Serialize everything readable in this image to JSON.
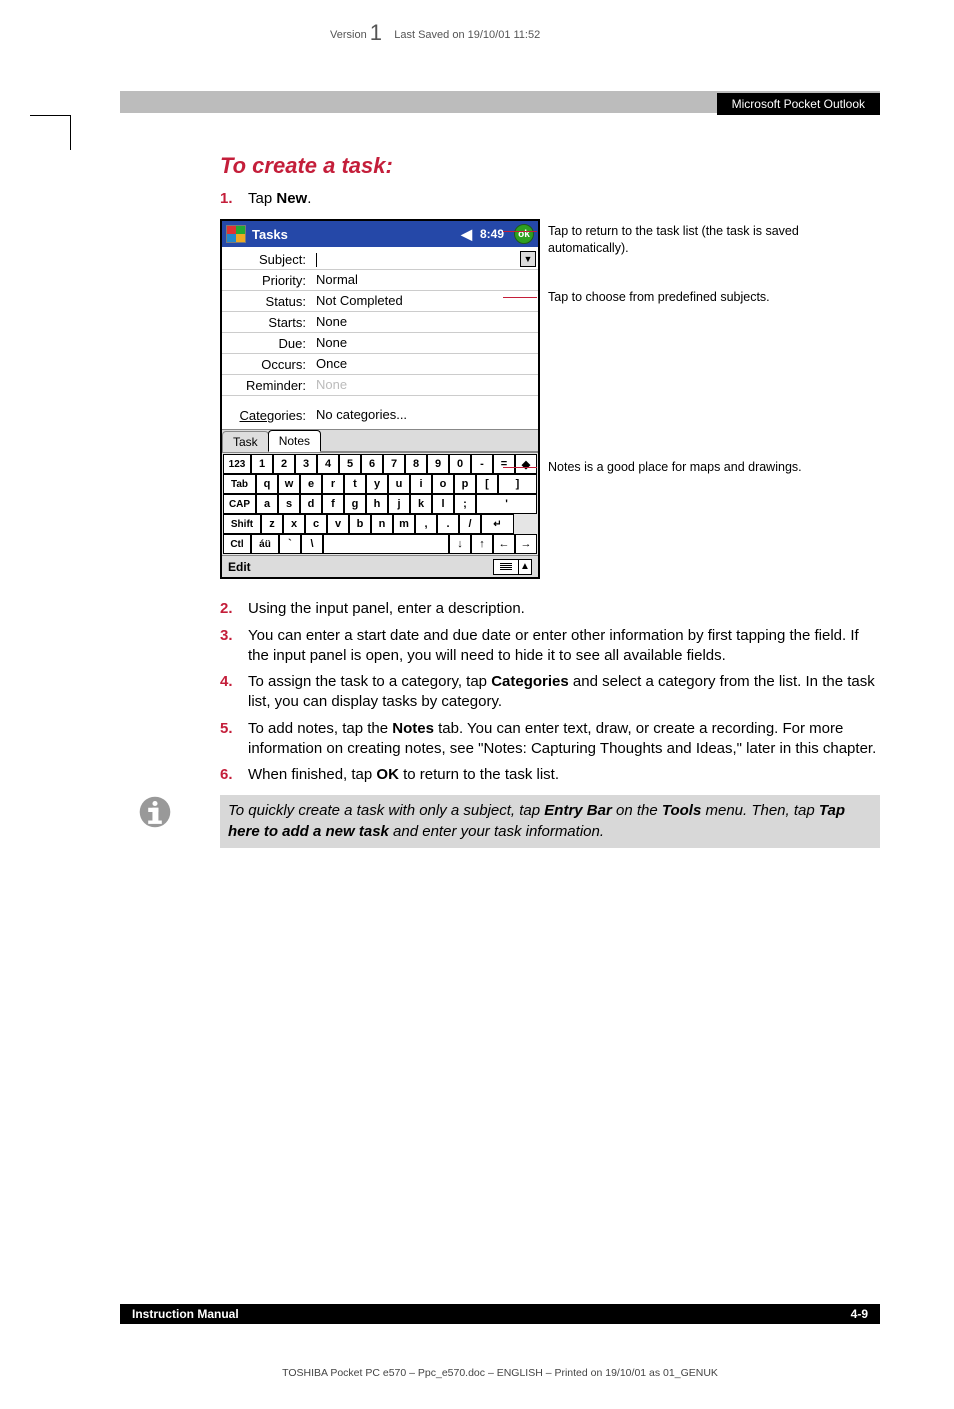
{
  "top_meta": {
    "version_prefix": "Version",
    "version_num": "1",
    "saved": "Last Saved on 19/10/01 11:52"
  },
  "header_bar": {
    "title": "Microsoft Pocket Outlook"
  },
  "section_title": "To create a task:",
  "steps": {
    "s1_pre": "Tap ",
    "s1_bold": "New",
    "s1_post": ".",
    "s2": "Using the input panel, enter a description.",
    "s3": "You can enter a start date and due date or enter other information by first tapping the field. If the input panel is open, you will need to hide it to see all available fields.",
    "s4_pre": "To assign the task to a category, tap ",
    "s4_bold": "Categories",
    "s4_post": " and select a category from the list. In the task list, you can display tasks by category.",
    "s5_pre": "To add notes, tap the ",
    "s5_bold": "Notes",
    "s5_post": " tab. You can enter text, draw, or create a recording. For more information on creating notes, see \"Notes: Capturing Thoughts and Ideas,\" later in this chapter.",
    "s6_pre": "When finished, tap ",
    "s6_bold": "OK",
    "s6_post": " to return to the task list."
  },
  "tip": {
    "pre1": "To quickly create a task with only a subject, tap ",
    "b1": "Entry Bar",
    "mid1": " on the ",
    "b2": "Tools",
    "mid2": " menu. Then, tap ",
    "b3": "Tap here to add a new task",
    "post": " and enter your task information."
  },
  "footer": {
    "left": "Instruction Manual",
    "right": "4-9",
    "note": "TOSHIBA Pocket PC e570   – Ppc_e570.doc – ENGLISH – Printed on 19/10/01 as 01_GENUK"
  },
  "annos": {
    "a1": "Tap to return to the task list (the task is saved automatically).",
    "a2": "Tap to choose from predefined subjects.",
    "a3": "Notes is a good place for maps and drawings."
  },
  "ppc": {
    "title": "Tasks",
    "time": "8:49",
    "ok": "ok",
    "fields": {
      "subject_label": "Subject:",
      "subject_value": "",
      "priority_label": "Priority:",
      "priority_value": "Normal",
      "status_label": "Status:",
      "status_value": "Not Completed",
      "starts_label": "Starts:",
      "starts_value": "None",
      "due_label": "Due:",
      "due_value": "None",
      "occurs_label": "Occurs:",
      "occurs_value": "Once",
      "reminder_label": "Reminder:",
      "reminder_value": "None",
      "categories_label": "Categories:",
      "categories_value": "No categories..."
    },
    "tabs": {
      "task": "Task",
      "notes": "Notes"
    },
    "keyboard": {
      "row1": [
        "123",
        "1",
        "2",
        "3",
        "4",
        "5",
        "6",
        "7",
        "8",
        "9",
        "0",
        "-",
        "=",
        "◆"
      ],
      "row2": [
        "Tab",
        "q",
        "w",
        "e",
        "r",
        "t",
        "y",
        "u",
        "i",
        "o",
        "p",
        "[",
        "]"
      ],
      "row3": [
        "CAP",
        "a",
        "s",
        "d",
        "f",
        "g",
        "h",
        "j",
        "k",
        "l",
        ";",
        "'"
      ],
      "row4": [
        "Shift",
        "z",
        "x",
        "c",
        "v",
        "b",
        "n",
        "m",
        ",",
        ".",
        "/",
        "↵"
      ],
      "row5": [
        "Ctl",
        "áü",
        "`",
        "\\",
        " ",
        "↓",
        "↑",
        "←",
        "→"
      ]
    },
    "bottombar": {
      "edit": "Edit"
    }
  }
}
